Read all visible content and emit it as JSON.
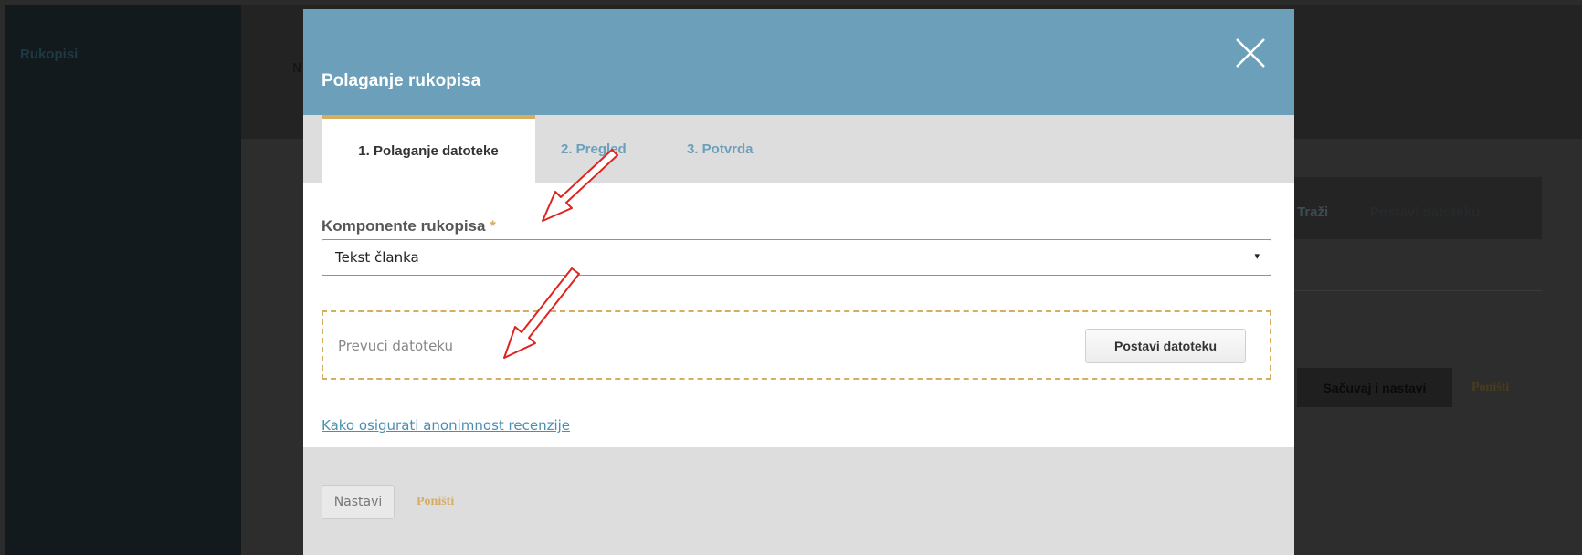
{
  "background": {
    "sidebar_title": "Rukopisi",
    "header_letter": "N",
    "toolbar": {
      "search_label": "Traži",
      "upload_label": "Postavi datoteku"
    },
    "save_label": "Sačuvaj i nastavi",
    "cancel_label": "Poništi"
  },
  "modal": {
    "title": "Polaganje rukopisa",
    "close_icon": "close-icon",
    "tabs": [
      {
        "label": "1. Polaganje datoteke",
        "active": true
      },
      {
        "label": "2. Pregled",
        "active": false
      },
      {
        "label": "3. Potvrda",
        "active": false
      }
    ],
    "component_label": "Komponente rukopisa",
    "required_mark": "*",
    "component_value": "Tekst članka",
    "select_arrow": "▾",
    "dropzone_text": "Prevuci datoteku",
    "upload_button": "Postavi datoteku",
    "anonymity_link": "Kako osigurati anonimnost recenzije",
    "footer": {
      "next_label": "Nastavi",
      "cancel_label": "Poništi"
    }
  },
  "colors": {
    "header": "#6b9fba",
    "accent": "#d5ae62",
    "link": "#4a8fb3",
    "annotation_arrow": "#e0231f"
  }
}
